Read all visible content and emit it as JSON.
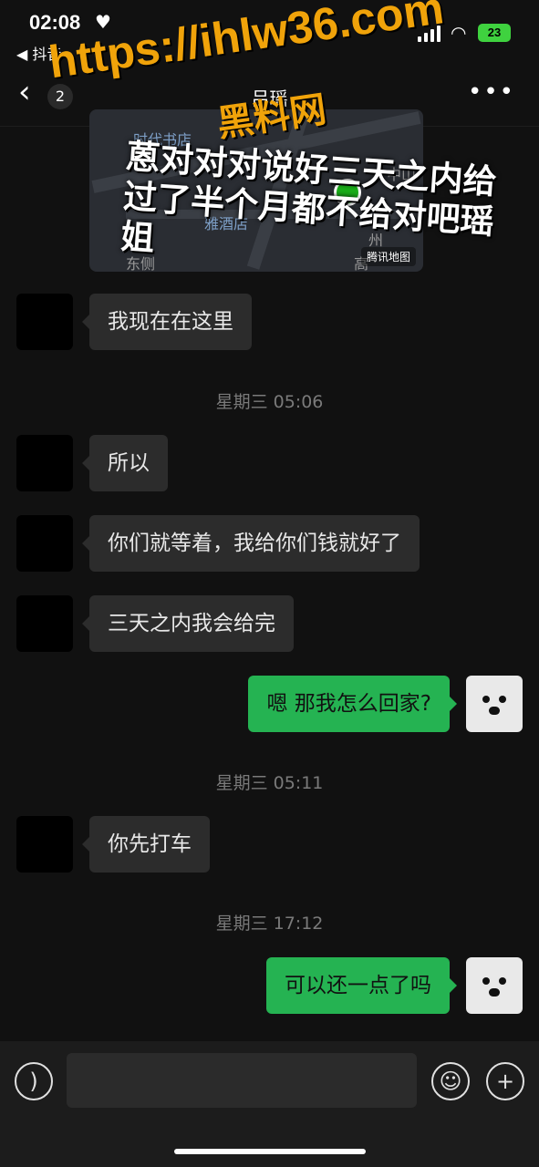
{
  "status_bar": {
    "time": "02:08",
    "heart": "♥",
    "back_app": "◀ 抖音",
    "battery": "23"
  },
  "nav": {
    "back_glyph": "‹",
    "unread_count": "2",
    "title": "吕瑶",
    "more_glyph": "•••"
  },
  "map": {
    "labels": [
      "时代书店",
      "雅酒店",
      "中山",
      "东侧",
      "州",
      "高"
    ],
    "badge": "腾讯地图"
  },
  "overlays": {
    "watermark_url": "https://ihlw36.com",
    "watermark_name": "黑料网",
    "caption": "蒽对对对说好三天之内给过了半个月都不给对吧瑶姐"
  },
  "messages": [
    {
      "type": "in",
      "text": "我现在在这里"
    },
    {
      "type": "time",
      "text": "星期三 05:06"
    },
    {
      "type": "in",
      "text": "所以"
    },
    {
      "type": "in",
      "text": "你们就等着，我给你们钱就好了"
    },
    {
      "type": "in",
      "text": "三天之内我会给完"
    },
    {
      "type": "out",
      "text": "嗯 那我怎么回家?"
    },
    {
      "type": "time",
      "text": "星期三 05:11"
    },
    {
      "type": "in",
      "text": "你先打车"
    },
    {
      "type": "time",
      "text": "星期三 17:12"
    },
    {
      "type": "out",
      "text": "可以还一点了吗"
    }
  ],
  "input_bar": {
    "voice_icon": "voice-icon",
    "emoji_icon": "emoji-icon",
    "plus_icon": "plus-icon"
  },
  "colors": {
    "background": "#111111",
    "incoming_bubble": "#2c2c2c",
    "outgoing_bubble": "#25b352",
    "watermark": "#f0a30a"
  }
}
